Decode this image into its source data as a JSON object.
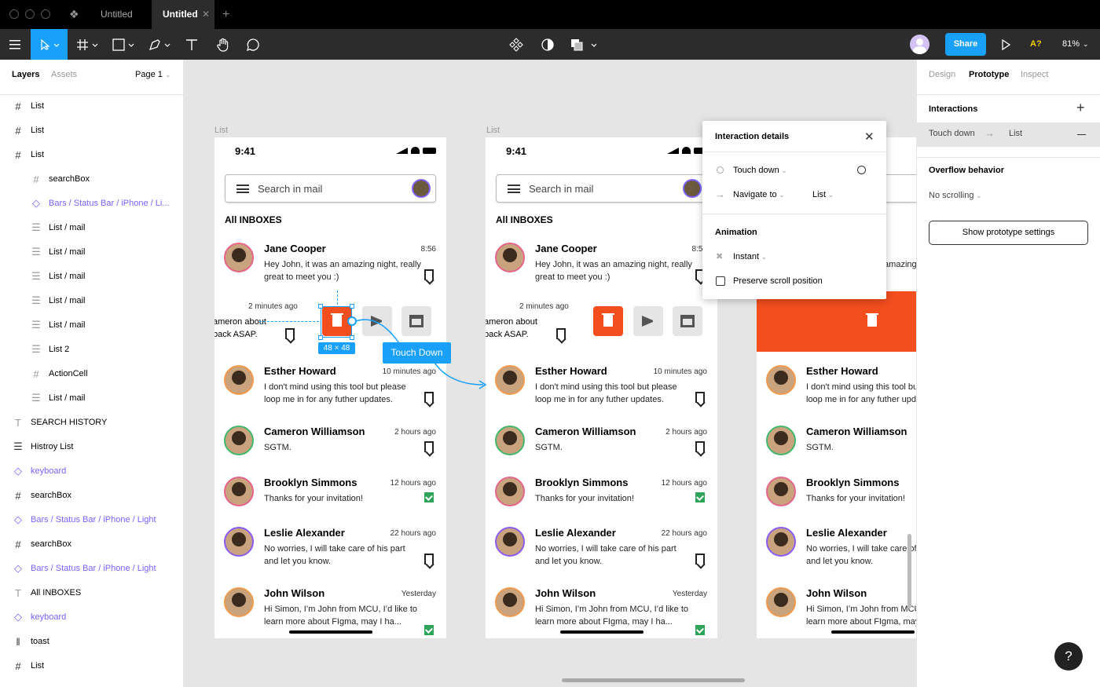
{
  "titlebar": {
    "tabs": [
      "Untitled",
      "Untitled"
    ]
  },
  "toolbar": {
    "share": "Share",
    "zoom": "81%",
    "font_missing": "A?"
  },
  "left_panel": {
    "tabs": [
      "Layers",
      "Assets"
    ],
    "page": "Page 1",
    "layers": [
      {
        "label": "List",
        "icon": "frame-icon",
        "indent": 0,
        "kind": "frame"
      },
      {
        "label": "List",
        "icon": "frame-icon",
        "indent": 0,
        "kind": "frame"
      },
      {
        "label": "List",
        "icon": "frame-icon",
        "indent": 0,
        "kind": "frame"
      },
      {
        "label": "searchBox",
        "icon": "frame-icon",
        "indent": 1,
        "kind": "frame"
      },
      {
        "label": "Bars / Status Bar / iPhone / Li...",
        "icon": "component-instance-icon",
        "indent": 1,
        "kind": "comp"
      },
      {
        "label": "List / mail",
        "icon": "auto-layout-icon",
        "indent": 1,
        "kind": "frame"
      },
      {
        "label": "List / mail",
        "icon": "auto-layout-icon",
        "indent": 1,
        "kind": "frame"
      },
      {
        "label": "List / mail",
        "icon": "auto-layout-icon",
        "indent": 1,
        "kind": "frame"
      },
      {
        "label": "List / mail",
        "icon": "auto-layout-icon",
        "indent": 1,
        "kind": "frame"
      },
      {
        "label": "List / mail",
        "icon": "auto-layout-icon",
        "indent": 1,
        "kind": "frame"
      },
      {
        "label": "List 2",
        "icon": "auto-layout-icon",
        "indent": 1,
        "kind": "frame"
      },
      {
        "label": "ActionCell",
        "icon": "frame-icon",
        "indent": 1,
        "kind": "frame"
      },
      {
        "label": "List / mail",
        "icon": "auto-layout-icon",
        "indent": 1,
        "kind": "frame"
      },
      {
        "label": "SEARCH HISTORY",
        "icon": "text-icon",
        "indent": 0,
        "kind": "frame"
      },
      {
        "label": "Histroy List",
        "icon": "auto-layout-icon",
        "indent": 0,
        "kind": "frame"
      },
      {
        "label": "keyboard",
        "icon": "component-instance-icon",
        "indent": 0,
        "kind": "comp"
      },
      {
        "label": "searchBox",
        "icon": "frame-icon",
        "indent": 0,
        "kind": "frame"
      },
      {
        "label": "Bars / Status Bar / iPhone / Light",
        "icon": "component-instance-icon",
        "indent": 0,
        "kind": "comp"
      },
      {
        "label": "searchBox",
        "icon": "frame-icon",
        "indent": 0,
        "kind": "frame"
      },
      {
        "label": "Bars / Status Bar / iPhone / Light",
        "icon": "component-instance-icon",
        "indent": 0,
        "kind": "comp"
      },
      {
        "label": "All INBOXES",
        "icon": "text-icon",
        "indent": 0,
        "kind": "frame"
      },
      {
        "label": "keyboard",
        "icon": "component-instance-icon",
        "indent": 0,
        "kind": "comp"
      },
      {
        "label": "toast",
        "icon": "columns-icon",
        "indent": 0,
        "kind": "frame"
      },
      {
        "label": "List",
        "icon": "frame-icon",
        "indent": 0,
        "kind": "frame"
      }
    ]
  },
  "canvas": {
    "frame_label": "List",
    "time": "9:41",
    "search_placeholder": "Search in mail",
    "inbox_heading": "All INBOXES",
    "mails": [
      {
        "name": "Jane Cooper",
        "time": "8:56",
        "text": "Hey John, it was an amazing night, really great to meet you :)",
        "mark": "bookmark"
      },
      {
        "name": "Esther Howard",
        "time": "10 minutes ago",
        "text": "I don't mind using this tool but please loop me in for any futher updates.",
        "mark": "bookmark"
      },
      {
        "name": "Cameron Williamson",
        "time": "2 hours ago",
        "text": "SGTM.",
        "mark": "bookmark"
      },
      {
        "name": "Brooklyn Simmons",
        "time": "12 hours ago",
        "text": "Thanks for your invitation!",
        "mark": "check"
      },
      {
        "name": "Leslie Alexander",
        "time": "22 hours ago",
        "text": "No worries, I will take care of his part and let you know.",
        "mark": "bookmark"
      },
      {
        "name": "John Wilson",
        "time": "Yesterday",
        "text": "Hi Simon, I’m John from MCU, I’d like to learn more about FIgma, may I ha...",
        "mark": "check"
      }
    ],
    "swiped": {
      "time": "2 minutes ago",
      "text_line1": "ameron about",
      "text_line2": "back ASAP."
    },
    "selection_size": "48 × 48",
    "connector_label": "Touch Down"
  },
  "popup": {
    "title": "Interaction details",
    "trigger": "Touch down",
    "action": "Navigate to",
    "destination": "List",
    "animation_heading": "Animation",
    "animation": "Instant",
    "preserve_scroll": "Preserve scroll position"
  },
  "right_panel": {
    "tabs": [
      "Design",
      "Prototype",
      "Inspect"
    ],
    "interactions_heading": "Interactions",
    "interaction_trigger": "Touch down",
    "interaction_target": "List",
    "overflow_heading": "Overflow behavior",
    "overflow_value": "No scrolling",
    "settings_button": "Show prototype settings"
  }
}
